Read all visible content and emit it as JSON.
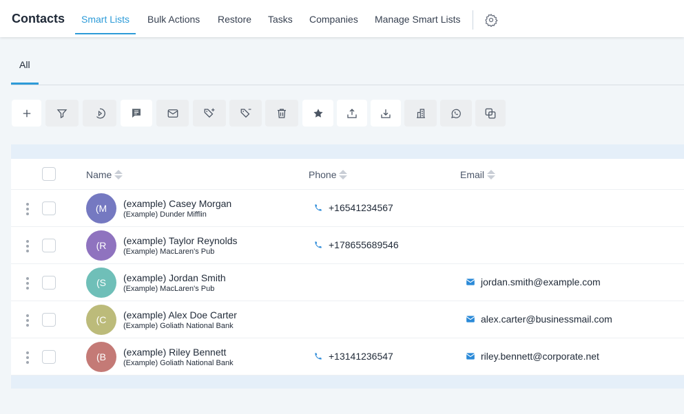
{
  "header": {
    "title": "Contacts",
    "nav": [
      "Smart Lists",
      "Bulk Actions",
      "Restore",
      "Tasks",
      "Companies",
      "Manage Smart Lists"
    ]
  },
  "tabs": {
    "all": "All"
  },
  "toolbar": [
    "add-icon",
    "filter-icon",
    "campaign-icon",
    "sms-icon",
    "email-icon",
    "add-tag-icon",
    "remove-tag-icon",
    "delete-icon",
    "star-icon",
    "export-icon",
    "import-icon",
    "company-icon",
    "whatsapp-icon",
    "merge-icon"
  ],
  "table": {
    "headers": {
      "name": "Name",
      "phone": "Phone",
      "email": "Email"
    },
    "rows": [
      {
        "initials": "(M",
        "name": "(example) Casey Morgan",
        "company": "(Example) Dunder Mifflin",
        "phone": "+16541234567",
        "email": "",
        "color": "#7579c1"
      },
      {
        "initials": "(R",
        "name": "(example) Taylor Reynolds",
        "company": "(Example) MacLaren's Pub",
        "phone": "+178655689546",
        "email": "",
        "color": "#8f73bf"
      },
      {
        "initials": "(S",
        "name": "(example) Jordan Smith",
        "company": "(Example) MacLaren's Pub",
        "phone": "",
        "email": "jordan.smith@example.com",
        "color": "#6fbfb8"
      },
      {
        "initials": "(C",
        "name": "(example) Alex Doe Carter",
        "company": "(Example) Goliath National Bank",
        "phone": "",
        "email": "alex.carter@businessmail.com",
        "color": "#bcbb7a"
      },
      {
        "initials": "(B",
        "name": "(example) Riley Bennett",
        "company": "(Example) Goliath National Bank",
        "phone": "+13141236547",
        "email": "riley.bennett@corporate.net",
        "color": "#c47a76"
      }
    ]
  }
}
